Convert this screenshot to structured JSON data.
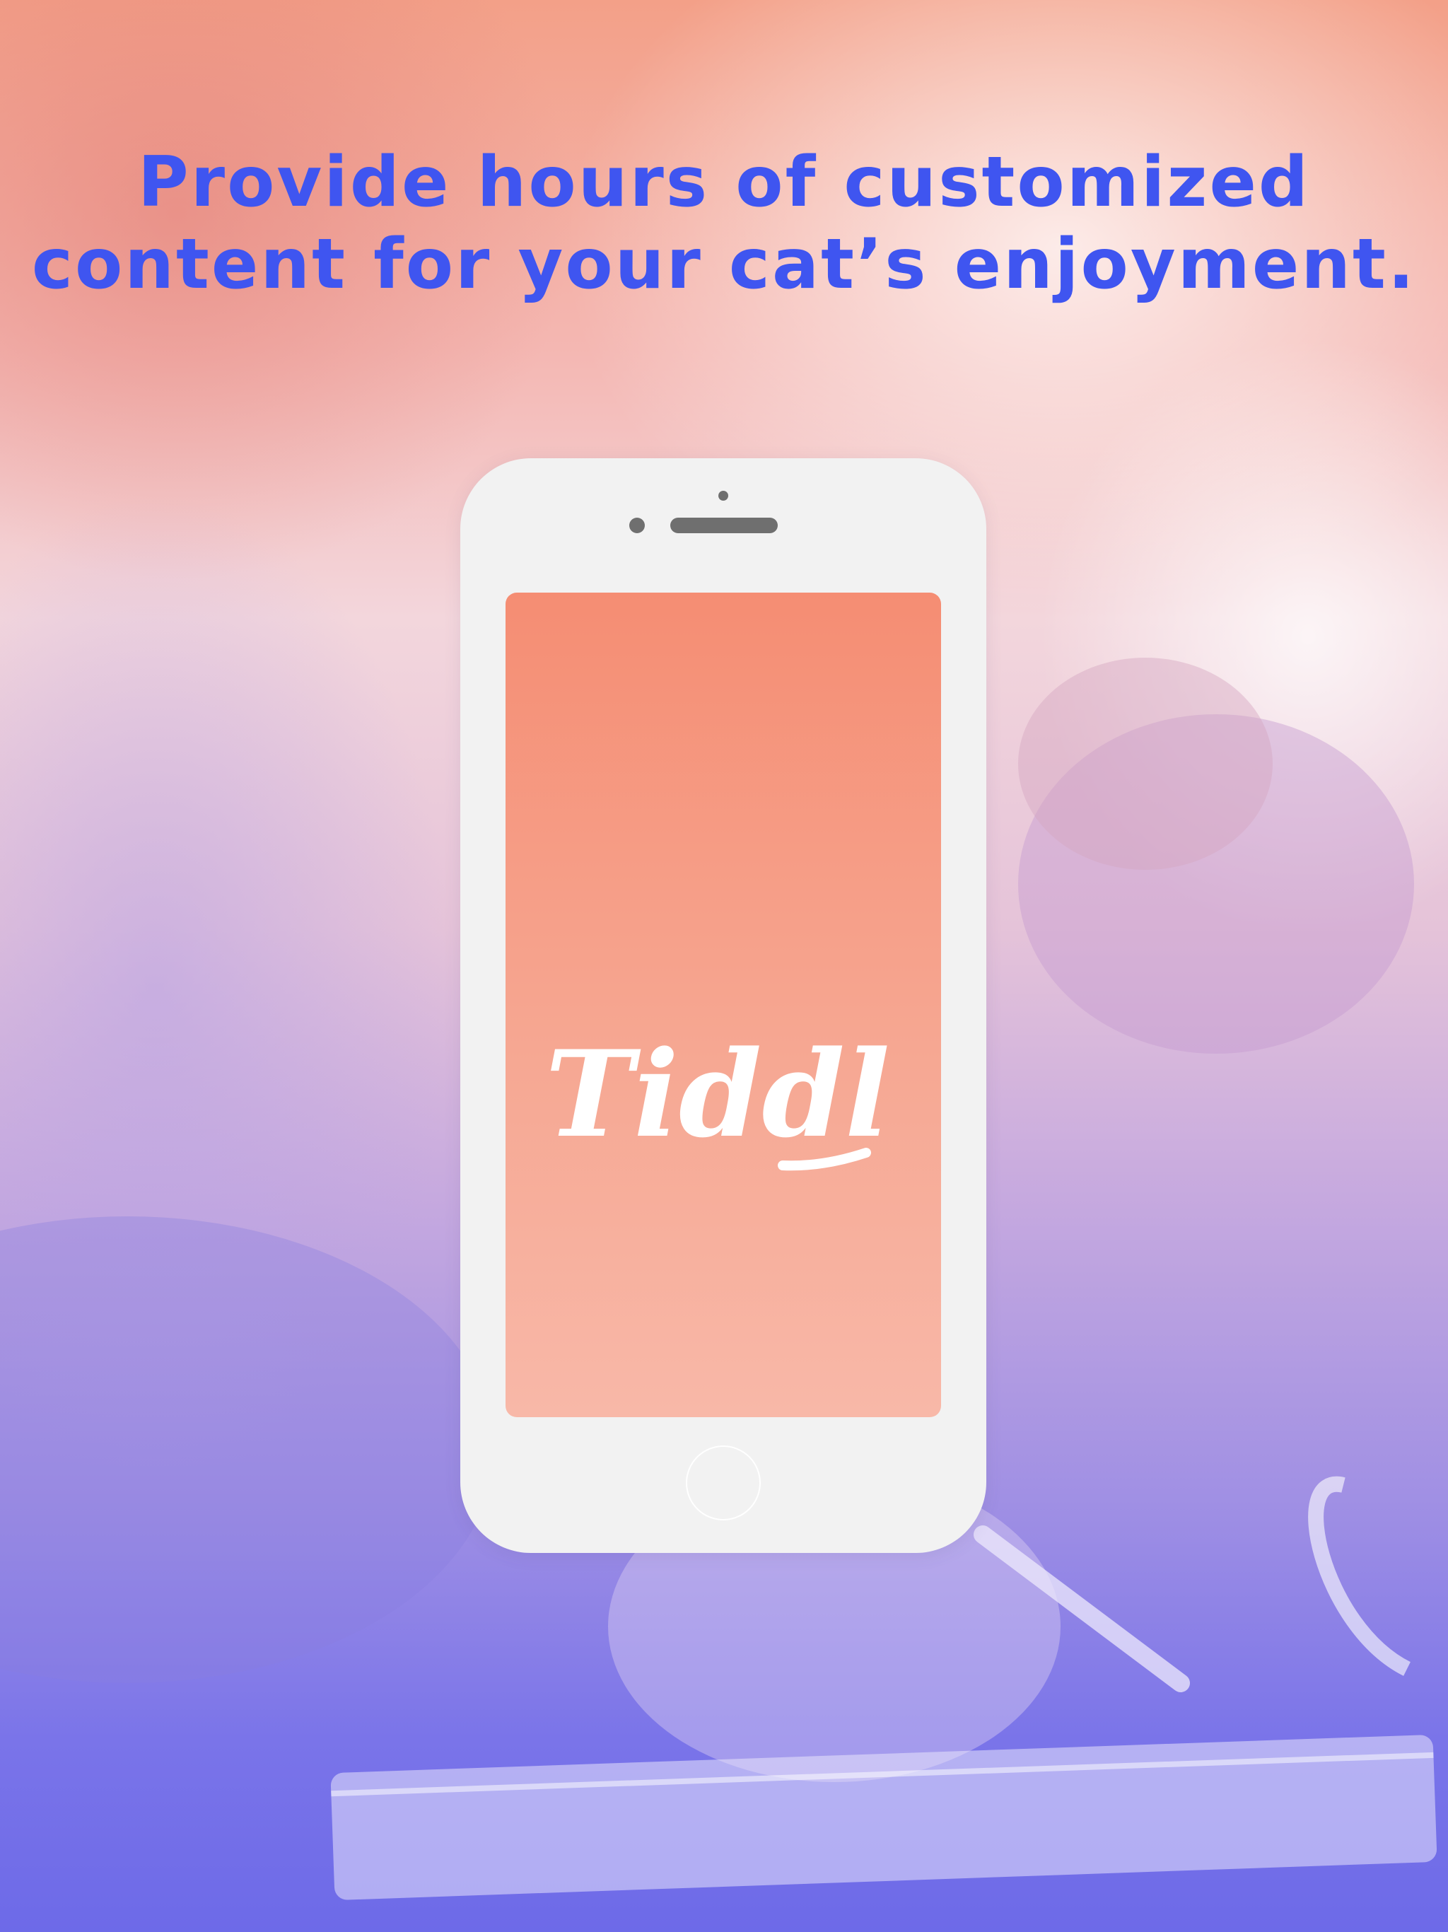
{
  "hero": {
    "headline_line1": "Provide hours of customized",
    "headline_line2": "content for your cat’s enjoyment.",
    "headline_color": "#3f55f0"
  },
  "phone": {
    "app_logo": "Tiddl",
    "screen_gradient_top": "#f58d73",
    "screen_gradient_bottom": "#f8b8a8",
    "body_color": "#f2f2f2"
  },
  "icons": {
    "home_button": "home-button-icon",
    "camera": "camera-icon",
    "speaker": "speaker-icon"
  }
}
